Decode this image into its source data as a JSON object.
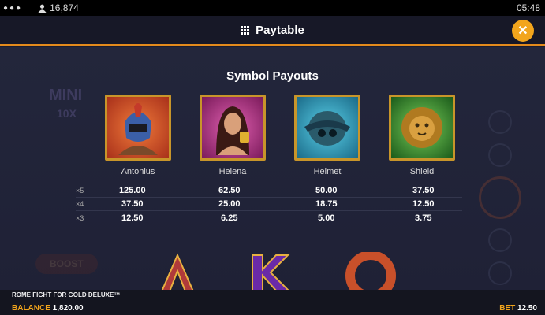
{
  "status_bar": {
    "menu_dots": "●●●",
    "player_count": "16,874",
    "time": "05:48"
  },
  "header": {
    "title": "Paytable",
    "close_symbol": "✕"
  },
  "background": {
    "mini_label": "MINI",
    "mini_mult": "10X",
    "boost_label": "BOOST"
  },
  "section": {
    "title": "Symbol Payouts"
  },
  "symbols": [
    {
      "name": "Antonius",
      "icon": "gladiator-icon",
      "bg": "#d9552a"
    },
    {
      "name": "Helena",
      "icon": "woman-icon",
      "bg": "#b13a8a"
    },
    {
      "name": "Helmet",
      "icon": "helmet-icon",
      "bg": "#2aa6c4"
    },
    {
      "name": "Shield",
      "icon": "lion-shield-icon",
      "bg": "#3a9a3a"
    }
  ],
  "payouts": [
    {
      "mult": "×5",
      "values": [
        "125.00",
        "62.50",
        "50.00",
        "37.50"
      ]
    },
    {
      "mult": "×4",
      "values": [
        "37.50",
        "25.00",
        "18.75",
        "12.50"
      ]
    },
    {
      "mult": "×3",
      "values": [
        "12.50",
        "6.25",
        "5.00",
        "3.75"
      ]
    }
  ],
  "footer": {
    "game_name": "ROME FIGHT FOR GOLD DELUXE™",
    "balance_label": "BALANCE",
    "balance_value": "1,820.00",
    "bet_label": "BET",
    "bet_value": "12.50"
  },
  "colors": {
    "accent": "#f2a51c",
    "header_border": "#e38a1c",
    "frame": "#c8952a"
  }
}
